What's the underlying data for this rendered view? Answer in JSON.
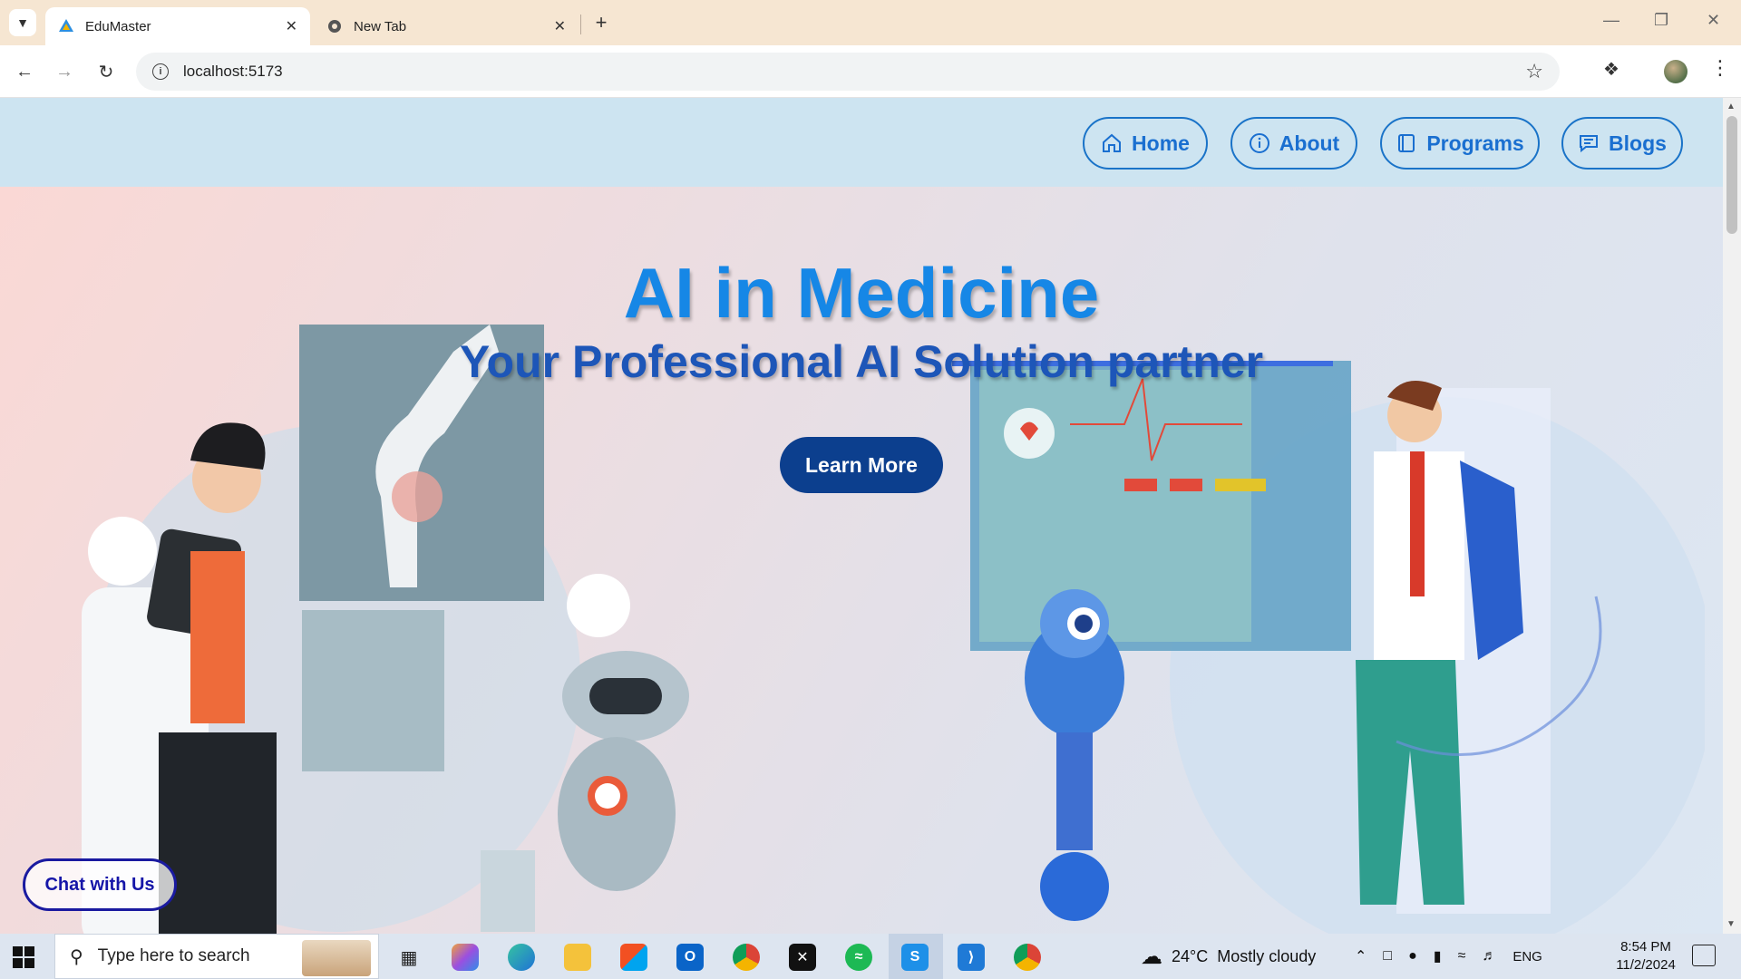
{
  "browser": {
    "tabs": [
      {
        "title": "EduMaster",
        "active": true
      },
      {
        "title": "New Tab",
        "active": false
      }
    ],
    "url": "localhost:5173",
    "window_controls": [
      "minimize",
      "restore",
      "close"
    ]
  },
  "site": {
    "nav": [
      {
        "label": "Home",
        "icon": "home-icon"
      },
      {
        "label": "About",
        "icon": "info-icon"
      },
      {
        "label": "Programs",
        "icon": "book-icon"
      },
      {
        "label": "Blogs",
        "icon": "chat-icon"
      }
    ],
    "hero": {
      "title": "AI in Medicine",
      "subtitle": "Your Professional AI Solution partner",
      "cta": "Learn More"
    },
    "chat_button": "Chat with Us",
    "colors": {
      "title": "#1687e6",
      "subtitle": "#1d56b8",
      "cta_bg": "#0c3f8e",
      "nav_border": "#1a73c8",
      "header_bg": "#cde4f1"
    }
  },
  "taskbar": {
    "search_placeholder": "Type here to search",
    "weather": {
      "temp": "24°C",
      "condition": "Mostly cloudy"
    },
    "language": "ENG",
    "time": "8:54 PM",
    "date": "11/2/2024"
  }
}
